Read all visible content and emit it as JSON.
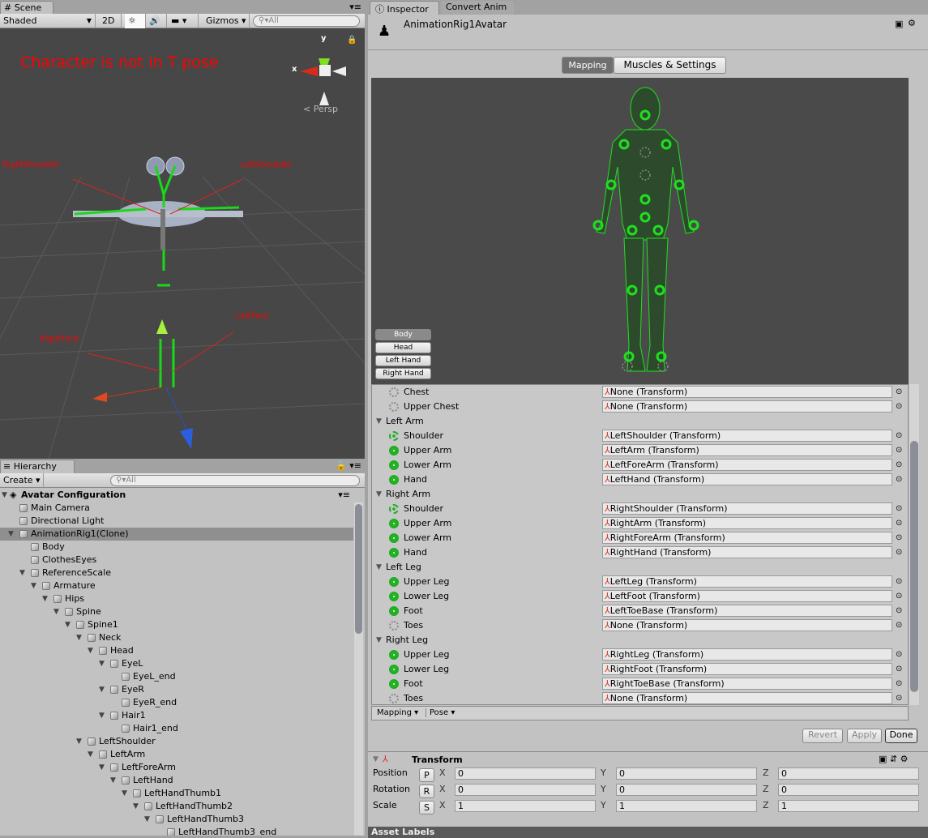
{
  "scene": {
    "tab": "Scene",
    "shading": "Shaded",
    "mode_2d": "2D",
    "gizmos": "Gizmos",
    "search_placeholder": "All",
    "warning": "Character is not in T pose",
    "persp": "Persp",
    "axis_x": "x",
    "axis_y": "y",
    "bone_labels": {
      "right_shoulder": "RightShoulder",
      "left_shoulder": "LeftShoulder",
      "right_foot": "RightFoot",
      "left_foot": "LeftFoot"
    },
    "warning_color": "#ff0000"
  },
  "hierarchy": {
    "tab": "Hierarchy",
    "create": "Create",
    "search_placeholder": "All",
    "scene_name": "Avatar Configuration",
    "items": [
      {
        "label": "Main Camera",
        "depth": 1
      },
      {
        "label": "Directional Light",
        "depth": 1
      },
      {
        "label": "AnimationRig1(Clone)",
        "depth": 1,
        "expanded": true,
        "selected": true
      },
      {
        "label": "Body",
        "depth": 2
      },
      {
        "label": "ClothesEyes",
        "depth": 2
      },
      {
        "label": "ReferenceScale",
        "depth": 2,
        "expanded": true
      },
      {
        "label": "Armature",
        "depth": 3,
        "expanded": true
      },
      {
        "label": "Hips",
        "depth": 4,
        "expanded": true
      },
      {
        "label": "Spine",
        "depth": 5,
        "expanded": true
      },
      {
        "label": "Spine1",
        "depth": 6,
        "expanded": true
      },
      {
        "label": "Neck",
        "depth": 7,
        "expanded": true
      },
      {
        "label": "Head",
        "depth": 8,
        "expanded": true
      },
      {
        "label": "EyeL",
        "depth": 9,
        "expanded": true
      },
      {
        "label": "EyeL_end",
        "depth": 10
      },
      {
        "label": "EyeR",
        "depth": 9,
        "expanded": true
      },
      {
        "label": "EyeR_end",
        "depth": 10
      },
      {
        "label": "Hair1",
        "depth": 9,
        "expanded": true
      },
      {
        "label": "Hair1_end",
        "depth": 10
      },
      {
        "label": "LeftShoulder",
        "depth": 7,
        "expanded": true
      },
      {
        "label": "LeftArm",
        "depth": 8,
        "expanded": true
      },
      {
        "label": "LeftForeArm",
        "depth": 9,
        "expanded": true
      },
      {
        "label": "LeftHand",
        "depth": 10,
        "expanded": true
      },
      {
        "label": "LeftHandThumb1",
        "depth": 11,
        "expanded": true
      },
      {
        "label": "LeftHandThumb2",
        "depth": 12,
        "expanded": true
      },
      {
        "label": "LeftHandThumb3",
        "depth": 13,
        "expanded": true
      },
      {
        "label": "LeftHandThumb3_end",
        "depth": 14
      }
    ]
  },
  "inspector": {
    "tabs": [
      "Inspector",
      "Convert Anim"
    ],
    "object_name": "AnimationRig1Avatar",
    "mode_tabs": [
      "Mapping",
      "Muscles & Settings"
    ],
    "body_buttons": [
      "Body",
      "Head",
      "Left Hand",
      "Right Hand"
    ],
    "rows": [
      {
        "type": "bone",
        "label": "Chest",
        "value": "None (Transform)",
        "state": "none"
      },
      {
        "type": "bone",
        "label": "Upper Chest",
        "value": "None (Transform)",
        "state": "none"
      },
      {
        "type": "group",
        "label": "Left Arm"
      },
      {
        "type": "bone",
        "label": "Shoulder",
        "value": "LeftShoulder (Transform)",
        "state": "opt"
      },
      {
        "type": "bone",
        "label": "Upper Arm",
        "value": "LeftArm (Transform)",
        "state": "ok"
      },
      {
        "type": "bone",
        "label": "Lower Arm",
        "value": "LeftForeArm (Transform)",
        "state": "ok"
      },
      {
        "type": "bone",
        "label": "Hand",
        "value": "LeftHand (Transform)",
        "state": "ok"
      },
      {
        "type": "group",
        "label": "Right Arm"
      },
      {
        "type": "bone",
        "label": "Shoulder",
        "value": "RightShoulder (Transform)",
        "state": "opt"
      },
      {
        "type": "bone",
        "label": "Upper Arm",
        "value": "RightArm (Transform)",
        "state": "ok"
      },
      {
        "type": "bone",
        "label": "Lower Arm",
        "value": "RightForeArm (Transform)",
        "state": "ok"
      },
      {
        "type": "bone",
        "label": "Hand",
        "value": "RightHand (Transform)",
        "state": "ok"
      },
      {
        "type": "group",
        "label": "Left Leg"
      },
      {
        "type": "bone",
        "label": "Upper Leg",
        "value": "LeftLeg (Transform)",
        "state": "ok"
      },
      {
        "type": "bone",
        "label": "Lower Leg",
        "value": "LeftFoot (Transform)",
        "state": "ok"
      },
      {
        "type": "bone",
        "label": "Foot",
        "value": "LeftToeBase (Transform)",
        "state": "ok"
      },
      {
        "type": "bone",
        "label": "Toes",
        "value": "None (Transform)",
        "state": "none"
      },
      {
        "type": "group",
        "label": "Right Leg"
      },
      {
        "type": "bone",
        "label": "Upper Leg",
        "value": "RightLeg (Transform)",
        "state": "ok"
      },
      {
        "type": "bone",
        "label": "Lower Leg",
        "value": "RightFoot (Transform)",
        "state": "ok"
      },
      {
        "type": "bone",
        "label": "Foot",
        "value": "RightToeBase (Transform)",
        "state": "ok"
      },
      {
        "type": "bone",
        "label": "Toes",
        "value": "None (Transform)",
        "state": "none"
      }
    ],
    "footer_menus": [
      "Mapping",
      "Pose"
    ],
    "revert": "Revert",
    "apply": "Apply",
    "done": "Done",
    "transform": {
      "title": "Transform",
      "rows": [
        {
          "label": "Position",
          "btn": "P",
          "x": "0",
          "y": "0",
          "z": "0"
        },
        {
          "label": "Rotation",
          "btn": "R",
          "x": "0",
          "y": "0",
          "z": "0"
        },
        {
          "label": "Scale",
          "btn": "S",
          "x": "1",
          "y": "1",
          "z": "1"
        }
      ]
    },
    "asset_labels": "Asset Labels"
  }
}
